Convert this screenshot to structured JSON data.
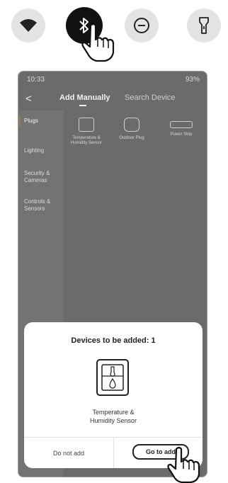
{
  "status_bar": {
    "time": "10:33",
    "right": "93%"
  },
  "tabs": {
    "back": "<",
    "add_manually": "Add Manually",
    "search_device": "Search Device"
  },
  "categories": [
    {
      "label": "Plugs"
    },
    {
      "label": "Lighting"
    },
    {
      "label": "Security & Cameras"
    },
    {
      "label": "Controls & Sensors"
    }
  ],
  "devices": [
    {
      "label": "Temperature & Humidity Sensor",
      "icon": "sensor-icon"
    },
    {
      "label": "Outdoor Plug",
      "icon": "outdoor-plug-icon"
    },
    {
      "label": "Power Strip",
      "icon": "power-strip-icon"
    }
  ],
  "dialog": {
    "title": "Devices to be added: 1",
    "device_name_line1": "Temperature &",
    "device_name_line2": "Humidity Sensor",
    "do_not_add": "Do not add",
    "go_to_add": "Go to add"
  },
  "colors": {
    "bluetooth_active": "#111111",
    "toggle_inactive": "#e3e3e3",
    "overlay": "#6b6b6b"
  }
}
